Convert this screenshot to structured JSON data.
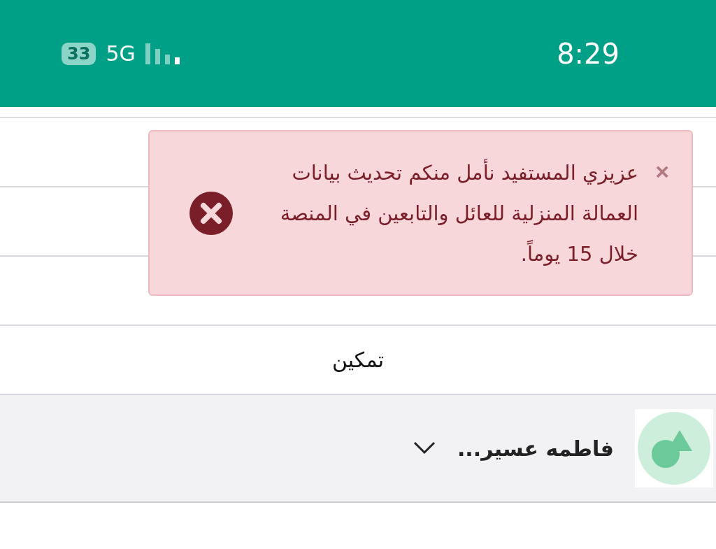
{
  "status_bar": {
    "battery": "33",
    "network": "5G",
    "time": "8:29"
  },
  "menu_items": [
    {
      "label": "تمكين"
    }
  ],
  "user": {
    "name": "فاطمه عسير...",
    "expanded": false
  },
  "alert": {
    "kind": "error",
    "close": "×",
    "message": "عزيزي المستفيد نأمل منكم تحديث بيانات العمالة المنزلية للعائل والتابعين في المنصة خلال 15 يوماً."
  }
}
